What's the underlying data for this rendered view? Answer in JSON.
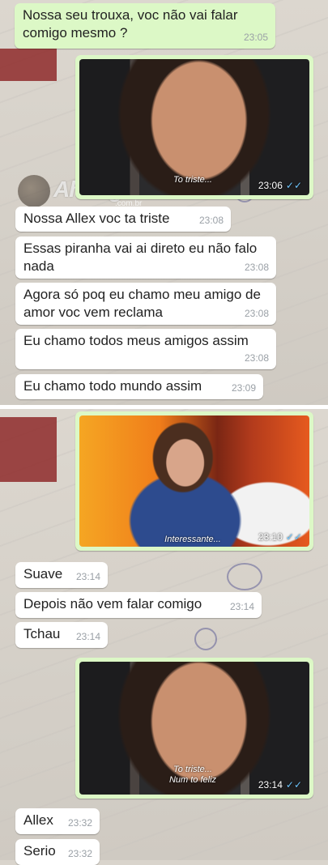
{
  "messages": {
    "m1": {
      "text": "Nossa seu trouxa, voc não vai falar comigo mesmo ?",
      "time": "23:05"
    },
    "p1": {
      "caption": "To triste...",
      "time": "23:06",
      "ticks": "✓✓"
    },
    "m2": {
      "text": "Nossa Allex voc ta triste",
      "time": "23:08"
    },
    "m3": {
      "text": "Essas piranha vai ai direto eu não falo nada",
      "time": "23:08"
    },
    "m4": {
      "text": "Agora só poq eu chamo meu amigo de amor voc vem reclama",
      "time": "23:08"
    },
    "m5": {
      "text": "Eu chamo todos meus amigos assim",
      "time": "23:08"
    },
    "m6": {
      "text": "Eu chamo todo mundo assim",
      "time": "23:09"
    },
    "p2": {
      "caption": "Interessante...",
      "time": "23:10",
      "ticks": "✓✓"
    },
    "m7": {
      "text": "Suave",
      "time": "23:14"
    },
    "m8": {
      "text": "Depois não vem falar comigo",
      "time": "23:14"
    },
    "m9": {
      "text": "Tchau",
      "time": "23:14"
    },
    "p3": {
      "caption_line1": "To triste...",
      "caption_line2": "Num to feliz",
      "time": "23:14",
      "ticks": "✓✓"
    },
    "m10": {
      "text": "Allex",
      "time": "23:32"
    },
    "m11": {
      "text": "Serio",
      "time": "23:32"
    }
  },
  "watermark": {
    "brand": "AhNegão!",
    "domain": ".com.br"
  },
  "colors": {
    "incoming": "#ffffff",
    "outgoing": "#dcf8c6",
    "read_ticks": "#6fc7ff"
  }
}
